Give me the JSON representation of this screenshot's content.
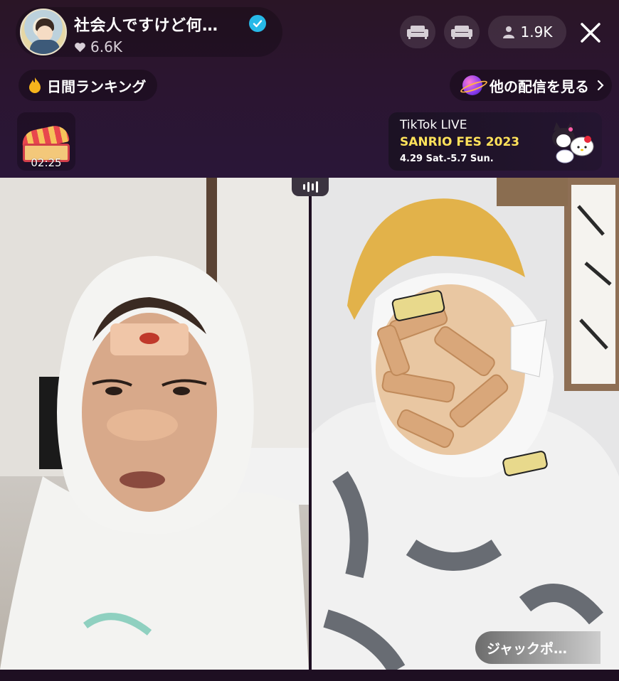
{
  "host": {
    "name": "社会人ですけど何…",
    "likes": "6.6K"
  },
  "viewers": "1.9K",
  "ranking": {
    "label": "日間ランキング"
  },
  "other_streams": {
    "label": "他の配信を見る"
  },
  "treasure": {
    "timer": "02:25"
  },
  "banner": {
    "line1": "TikTok LIVE",
    "line2": "SANRIO FES 2023",
    "line3": "4.29 Sat.-5.7 Sun."
  },
  "jackpot": {
    "label": "ジャックポ…"
  },
  "colors": {
    "background": "#2a1526",
    "verified": "#27b9e8",
    "banner_accent": "#ffe25a"
  }
}
